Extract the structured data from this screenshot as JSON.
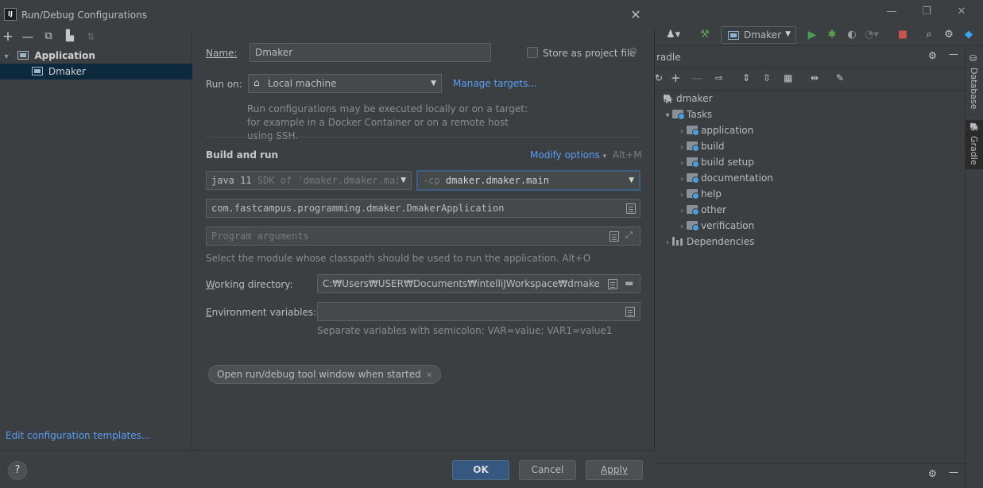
{
  "dialog": {
    "title": "Run/Debug Configurations",
    "logo_text": "IJ",
    "close_glyph": "✕"
  },
  "left_pane": {
    "toolbar": [
      "add-icon",
      "remove-icon",
      "copy-icon",
      "move-into-folder-icon",
      "sort-icon"
    ],
    "tree": {
      "group_label": "Application",
      "item_label": "Dmaker"
    },
    "edit_templates": "Edit configuration templates..."
  },
  "form": {
    "name_label": "Name:",
    "name_value": "Dmaker",
    "store_label": "Store as project file",
    "run_on_label": "Run on:",
    "run_on_value": "Local machine",
    "manage_targets": "Manage targets...",
    "run_on_hint": "Run configurations may be executed locally or on a target: for example in a Docker Container or on a remote host using SSH.",
    "build_and_run": "Build and run",
    "modify_options": "Modify options",
    "modify_shortcut": "Alt+M",
    "jdk_prefix": "java 11",
    "jdk_suffix": "SDK of 'dmaker.dmaker.mai",
    "cp_flag": "-cp",
    "cp_value": "dmaker.dmaker.main",
    "main_class": "com.fastcampus.programming.dmaker.DmakerApplication",
    "program_args_placeholder": "Program arguments",
    "module_hint": "Select the module whose classpath should be used to run the application. Alt+O",
    "working_dir_label": "Working directory:",
    "working_dir_value": "C:₩Users₩USER₩Documents₩intelliJWorkspace₩dmaker",
    "env_label": "Environment variables:",
    "env_hint": "Separate variables with semicolon: VAR=value; VAR1=value1",
    "pill": "Open run/debug tool window when started"
  },
  "footer": {
    "help": "?",
    "ok": "OK",
    "cancel": "Cancel",
    "apply": "Apply"
  },
  "ide": {
    "run_config": "Dmaker",
    "gradle_title": "radle",
    "tree": {
      "root": "dmaker",
      "tasks": "Tasks",
      "task_groups": [
        "application",
        "build",
        "build setup",
        "documentation",
        "help",
        "other",
        "verification"
      ],
      "dependencies": "Dependencies"
    },
    "side_tabs": [
      "Database",
      "Gradle"
    ],
    "colors": {
      "run_green": "#499c54",
      "stop_red": "#c75450",
      "link_blue": "#589df6",
      "selection": "#0d293e"
    }
  }
}
